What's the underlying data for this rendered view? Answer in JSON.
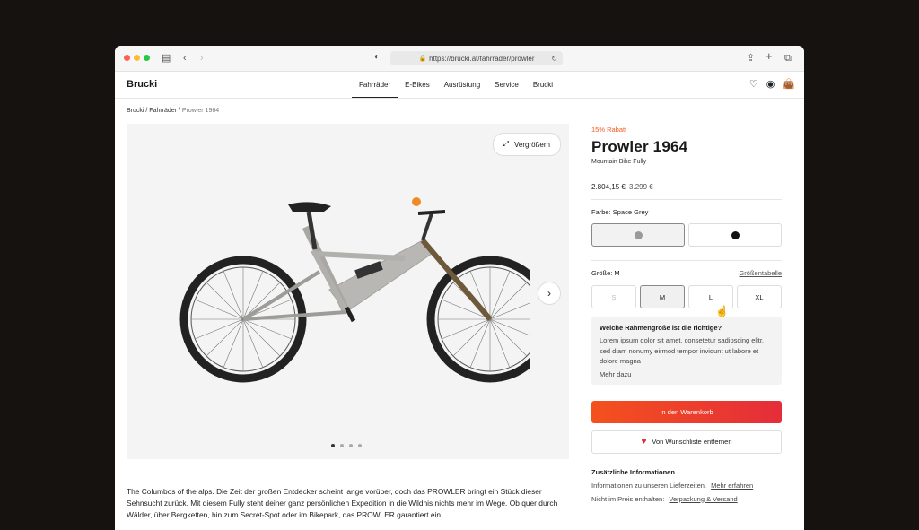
{
  "browser": {
    "url": "https://brucki.at/fahrräder/prowler"
  },
  "nav": {
    "logo": "Brucki",
    "items": [
      "Fahrräder",
      "E-Bikes",
      "Ausrüstung",
      "Service",
      "Brucki"
    ]
  },
  "breadcrumb": {
    "parts": [
      "Brucki",
      "Fahrräder"
    ],
    "current": "Prowler 1964"
  },
  "gallery": {
    "zoom_label": "Vergrößern",
    "pages": 4,
    "current_page": 1
  },
  "product": {
    "discount": "15% Rabatt",
    "title": "Prowler 1964",
    "subtitle": "Mountain Bike Fully",
    "price": "2.804,15 €",
    "old_price": "3.299 €",
    "color_label": "Farbe: Space Grey",
    "colors": [
      {
        "name": "space-grey",
        "hex": "#9a9a9a",
        "selected": true
      },
      {
        "name": "black",
        "hex": "#111111",
        "selected": false
      }
    ],
    "size_label": "Größe: M",
    "size_chart_link": "Größentabelle",
    "sizes": [
      "S",
      "M",
      "L",
      "XL"
    ],
    "selected_size": "M",
    "info_heading": "Welche Rahmengröße ist die richtige?",
    "info_text": "Lorem ipsum dolor sit amet, consetetur sadipscing elitr, sed diam nonumy eirmod tempor invidunt ut labore et dolore magna",
    "info_link": "Mehr dazu",
    "cart_button": "In den Warenkorb",
    "wishlist_button": "Von Wunschliste entfernen",
    "additional_heading": "Zusätzliche Informationen",
    "delivery_text": "Informationen zu unseren Lieferzeiten.",
    "delivery_link": "Mehr erfahren",
    "included_text": "Nicht im Preis enthalten:",
    "included_link": "Verpackung & Versand"
  },
  "description": "The Columbos of the alps. Die Zeit der großen Entdecker scheint lange vorüber, doch das PROWLER bringt ein Stück dieser Sehnsucht zurück. Mit diesem Fully steht deiner ganz persönlichen Expedition in die Wildnis nichts mehr im Wege. Ob quer durch Wälder, über Bergketten, hin zum Secret-Spot oder im Bikepark, das PROWLER garantiert ein",
  "colors": {
    "accent": "#f4511e",
    "accent_end": "#e52d3a"
  }
}
